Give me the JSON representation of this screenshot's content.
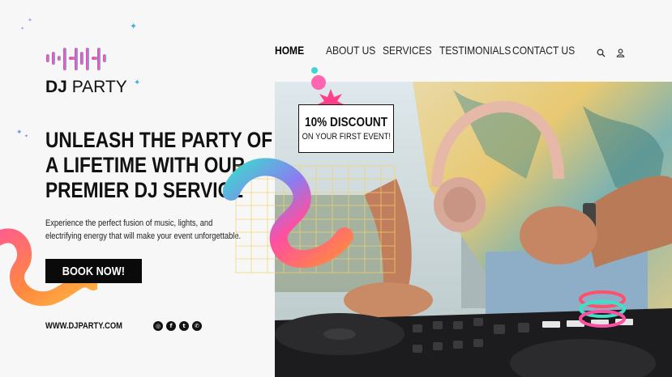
{
  "brand": {
    "bold": "DJ",
    "light": "PARTY"
  },
  "nav": {
    "items": [
      {
        "label": "HOME",
        "active": true
      },
      {
        "label": "ABOUT US",
        "active": false
      },
      {
        "label": "SERVICES",
        "active": false
      },
      {
        "label": "TESTIMONIALS",
        "active": false
      },
      {
        "label": "CONTACT US",
        "active": false
      }
    ],
    "icons": [
      "search-icon",
      "user-icon"
    ]
  },
  "hero": {
    "headline_lines": [
      "UNLEASH THE PARTY OF",
      "A LIFETIME WITH OUR",
      "PREMIER DJ SERVICE"
    ],
    "description": "Experience the perfect fusion of music, lights, and electrifying energy that will make your event unforgettable.",
    "cta_label": "BOOK NOW!"
  },
  "footer": {
    "website": "WWW.DJPARTY.COM",
    "socials": [
      "instagram-icon",
      "facebook-icon",
      "twitter-icon",
      "whatsapp-icon"
    ]
  },
  "promo": {
    "line1": "10% DISCOUNT",
    "line2": "ON YOUR FIRST EVENT!"
  },
  "colors": {
    "background": "#f7f7f7",
    "text": "#111111",
    "button": "#0a0a0a",
    "accent_pink": "#ff4fa0",
    "accent_teal": "#3fd6d0",
    "accent_orange": "#ff8a3d",
    "grid_yellow": "#f3d97a"
  }
}
